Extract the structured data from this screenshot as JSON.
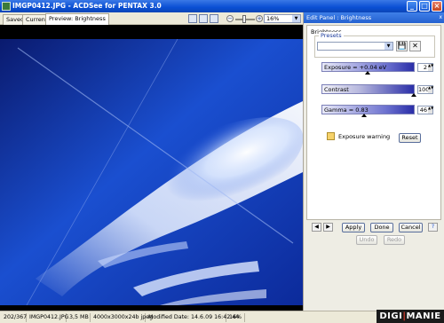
{
  "window": {
    "title": "IMGP0412.JPG - ACDSee for PENTAX 3.0",
    "minimize": "_",
    "maximize": "□",
    "close": "×"
  },
  "viewer_tabs": [
    "Saved",
    "Current",
    "Preview: Brightness"
  ],
  "toolbar": {
    "zoom_value": "16%",
    "zoom_out": "−",
    "zoom_in": "+"
  },
  "edit_panel": {
    "header": "Edit Panel : Brightness",
    "close": "x",
    "section_title": "Brightness",
    "presets_label": "Presets",
    "exposure": {
      "label": "Exposure = +0.04 eV",
      "value": "2",
      "level_fraction": 0.5
    },
    "contrast": {
      "label": "Contrast",
      "value": "100",
      "level_fraction": 1.0
    },
    "gamma": {
      "label": "Gamma = 0.83",
      "value": "46",
      "level_fraction": 0.46
    },
    "exposure_warning_label": "Exposure warning",
    "reset_label": "Reset",
    "apply_label": "Apply",
    "done_label": "Done",
    "cancel_label": "Cancel",
    "undo_label": "Undo",
    "redo_label": "Redo"
  },
  "status": {
    "position": "202/367",
    "filename": "IMGP0412.JPG",
    "filesize": "3,5 MB",
    "dimensions": "4000x3000x24b jpeg",
    "modified": "Modified Date: 14.6.09 16:42:44",
    "zoom": "16%"
  },
  "watermark": {
    "left": "DIGI",
    "right": "MANIE"
  },
  "colors": {
    "titlebar": "#0a4fd4",
    "sky_dark": "#050a40",
    "sky_blue": "#1a4fd0",
    "slider_blue": "#2a2ea8"
  }
}
